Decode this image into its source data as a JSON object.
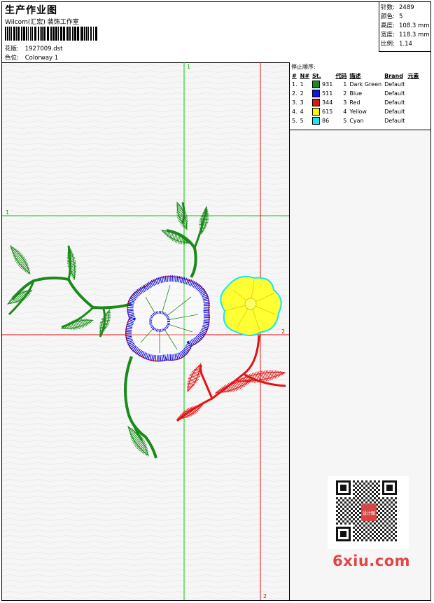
{
  "header": {
    "title": "生产作业图",
    "company": "Wilcom(汇宏) 装饰工作室",
    "design_label": "花版:",
    "design_file": "1927009.dst",
    "colorway_label": "色位:",
    "colorway": "Colorway 1"
  },
  "stats": [
    {
      "label": "针数:",
      "value": "2489"
    },
    {
      "label": "颜色:",
      "value": "5"
    },
    {
      "label": "高度:",
      "value": "108.3 mm"
    },
    {
      "label": "宽度:",
      "value": "118.3 mm"
    },
    {
      "label": "比例:",
      "value": "1.14"
    }
  ],
  "color_table": {
    "caption": "停止顺序:",
    "headers": [
      "#",
      "N#",
      "St.",
      "代码",
      "描述",
      "Brand",
      "元素"
    ],
    "rows": [
      {
        "num": "1.",
        "n": "1",
        "swatch": "#1a8a1a",
        "stitches": "931",
        "code": "1",
        "desc": "Dark Green",
        "brand": "Default"
      },
      {
        "num": "2.",
        "n": "2",
        "swatch": "#1414e0",
        "stitches": "511",
        "code": "2",
        "desc": "Blue",
        "brand": "Default"
      },
      {
        "num": "3.",
        "n": "3",
        "swatch": "#e01414",
        "stitches": "344",
        "code": "3",
        "desc": "Red",
        "brand": "Default"
      },
      {
        "num": "4.",
        "n": "4",
        "swatch": "#f5f50a",
        "stitches": "615",
        "code": "4",
        "desc": "Yellow",
        "brand": "Default"
      },
      {
        "num": "5.",
        "n": "5",
        "swatch": "#14e8f0",
        "stitches": "86",
        "code": "5",
        "desc": "Cyan",
        "brand": "Default"
      }
    ]
  },
  "guides": {
    "green_v_label": "1",
    "green_h_label": "1",
    "red_v_label": "2",
    "red_h_label": "2",
    "green_color": "#00cc00",
    "red_color": "#e01414"
  },
  "watermark": "6xiu.com",
  "qr_badge": "设计图"
}
